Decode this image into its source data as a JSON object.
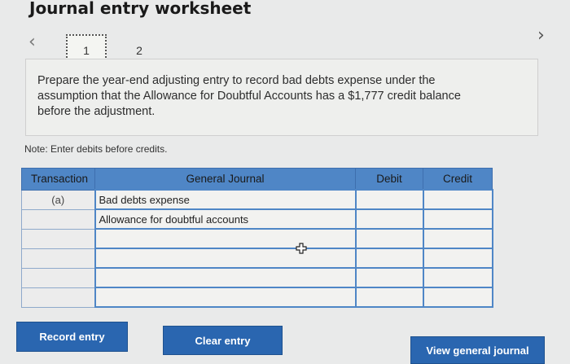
{
  "header": {
    "title": "Journal entry worksheet"
  },
  "nav": {
    "prev_icon": "chevron-left-icon",
    "next_icon": "chevron-right-icon",
    "prev_glyph": "‹",
    "next_glyph": "›",
    "pages": [
      "1",
      "2"
    ],
    "active_page": "1"
  },
  "prompt": {
    "text": "Prepare the year-end adjusting entry to record bad debts expense under the assumption that the Allowance for Doubtful Accounts has a $1,777 credit balance before the adjustment."
  },
  "note": "Note: Enter debits before credits.",
  "journal": {
    "headers": {
      "transaction": "Transaction",
      "general_journal": "General Journal",
      "debit": "Debit",
      "credit": "Credit"
    },
    "rows": [
      {
        "transaction": "(a)",
        "account": "Bad debts expense",
        "debit": "",
        "credit": ""
      },
      {
        "transaction": "",
        "account": "Allowance for doubtful accounts",
        "debit": "",
        "credit": ""
      },
      {
        "transaction": "",
        "account": "",
        "debit": "",
        "credit": ""
      },
      {
        "transaction": "",
        "account": "",
        "debit": "",
        "credit": ""
      },
      {
        "transaction": "",
        "account": "",
        "debit": "",
        "credit": ""
      },
      {
        "transaction": "",
        "account": "",
        "debit": "",
        "credit": ""
      }
    ]
  },
  "buttons": {
    "record": "Record entry",
    "clear": "Clear entry",
    "view": "View general journal"
  },
  "colors": {
    "accent": "#2a66b0",
    "header_blue": "#4f86c6",
    "background": "#e9eaea"
  },
  "cursor_icon": "move-cursor-icon"
}
